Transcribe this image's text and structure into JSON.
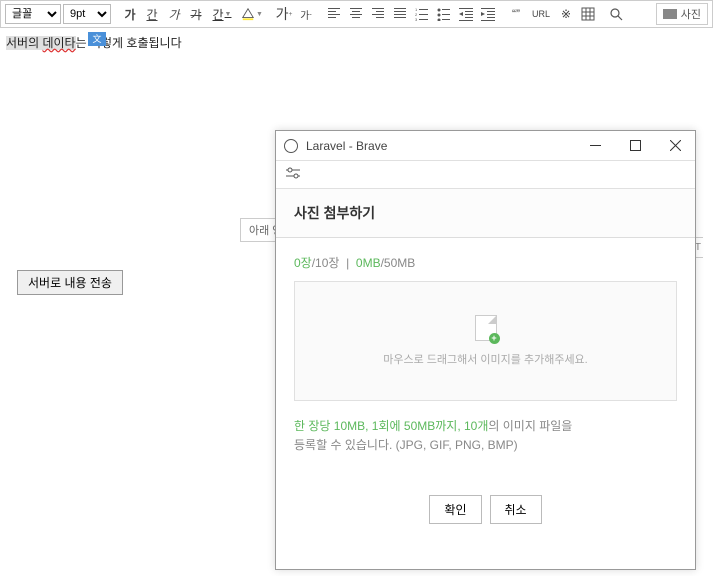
{
  "toolbar": {
    "font_select": "글꼴",
    "size_select": "9pt",
    "bold": "가",
    "underline": "간",
    "italic": "가",
    "strike": "갸",
    "fontcolor": "간",
    "bgcolor_icon": "paint",
    "fontsize_up": "가",
    "fontsize_down": "가",
    "quote": "“”",
    "url": "URL",
    "special": "※",
    "table_icon": "table",
    "find_icon": "find",
    "photo_label": "사진"
  },
  "editor": {
    "text_highlighted": "서버의 ",
    "text_spellcheck": "데이타",
    "text_rest": "는 이렇게 호출됩니다"
  },
  "drop_label": "아래 영역을",
  "txt_badge": "XT",
  "submit_btn": "서버로 내용 전송",
  "popup": {
    "title": "Laravel - Brave",
    "header": "사진 첨부하기",
    "quota_count_cur": "0장",
    "quota_count_max": "/10장",
    "quota_size_cur": "0MB",
    "quota_size_max": "/50MB",
    "dropzone_text": "마우스로 드래그해서 이미지를 추가해주세요.",
    "info_highlight": "한 장당 10MB, 1회에 50MB까지, 10개",
    "info_rest1": "의 이미지 파일을",
    "info_rest2": "등록할 수 있습니다. (JPG, GIF, PNG, BMP)",
    "ok": "확인",
    "cancel": "취소"
  }
}
